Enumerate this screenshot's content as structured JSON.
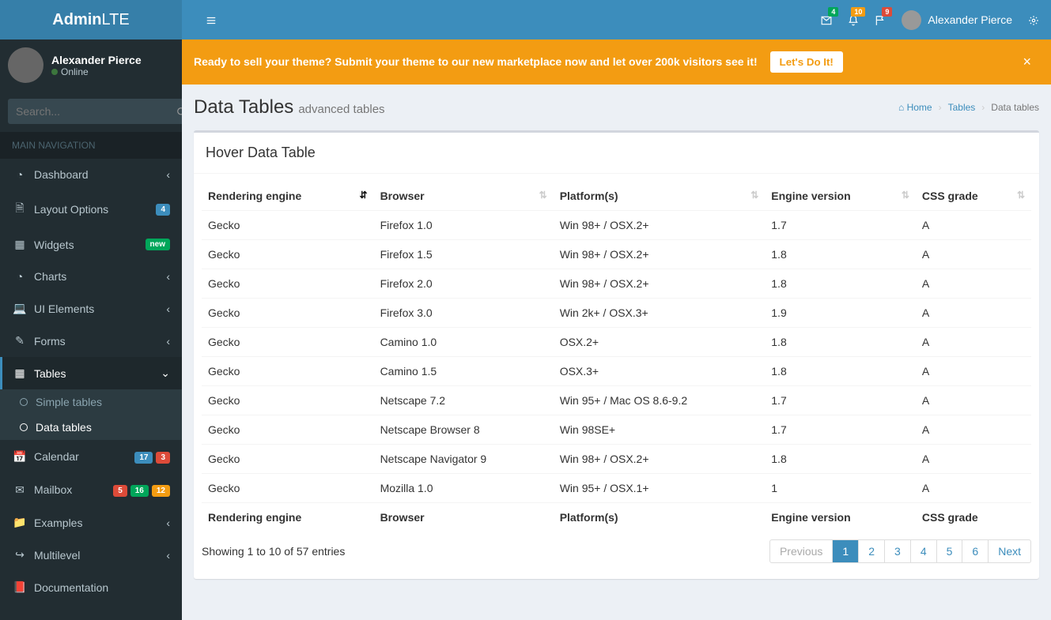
{
  "logo": {
    "b": "Admin",
    "rest": "LTE"
  },
  "header": {
    "badges": {
      "mail": "4",
      "bell": "10",
      "flag": "9"
    },
    "user_name": "Alexander Pierce"
  },
  "sidebar": {
    "user_name": "Alexander Pierce",
    "status": "Online",
    "search_placeholder": "Search...",
    "header": "MAIN NAVIGATION",
    "items": {
      "dashboard": "Dashboard",
      "layout": "Layout Options",
      "layout_badge": "4",
      "widgets": "Widgets",
      "widgets_badge": "new",
      "charts": "Charts",
      "ui": "UI Elements",
      "forms": "Forms",
      "tables": "Tables",
      "simple_tables": "Simple tables",
      "data_tables": "Data tables",
      "calendar": "Calendar",
      "calendar_b1": "17",
      "calendar_b2": "3",
      "mailbox": "Mailbox",
      "mail_b1": "5",
      "mail_b2": "16",
      "mail_b3": "12",
      "examples": "Examples",
      "multilevel": "Multilevel",
      "documentation": "Documentation"
    }
  },
  "alert": {
    "msg": "Ready to sell your theme? Submit your theme to our new marketplace now and let over 200k visitors see it!",
    "btn": "Let's Do It!"
  },
  "page": {
    "title": "Data Tables",
    "subtitle": "advanced tables",
    "crumb_home": "Home",
    "crumb_tables": "Tables",
    "crumb_active": "Data tables"
  },
  "box_title": "Hover Data Table",
  "table": {
    "columns": [
      "Rendering engine",
      "Browser",
      "Platform(s)",
      "Engine version",
      "CSS grade"
    ],
    "rows": [
      [
        "Gecko",
        "Firefox 1.0",
        "Win 98+ / OSX.2+",
        "1.7",
        "A"
      ],
      [
        "Gecko",
        "Firefox 1.5",
        "Win 98+ / OSX.2+",
        "1.8",
        "A"
      ],
      [
        "Gecko",
        "Firefox 2.0",
        "Win 98+ / OSX.2+",
        "1.8",
        "A"
      ],
      [
        "Gecko",
        "Firefox 3.0",
        "Win 2k+ / OSX.3+",
        "1.9",
        "A"
      ],
      [
        "Gecko",
        "Camino 1.0",
        "OSX.2+",
        "1.8",
        "A"
      ],
      [
        "Gecko",
        "Camino 1.5",
        "OSX.3+",
        "1.8",
        "A"
      ],
      [
        "Gecko",
        "Netscape 7.2",
        "Win 95+ / Mac OS 8.6-9.2",
        "1.7",
        "A"
      ],
      [
        "Gecko",
        "Netscape Browser 8",
        "Win 98SE+",
        "1.7",
        "A"
      ],
      [
        "Gecko",
        "Netscape Navigator 9",
        "Win 98+ / OSX.2+",
        "1.8",
        "A"
      ],
      [
        "Gecko",
        "Mozilla 1.0",
        "Win 95+ / OSX.1+",
        "1",
        "A"
      ]
    ],
    "info": "Showing 1 to 10 of 57 entries",
    "pages": [
      "Previous",
      "1",
      "2",
      "3",
      "4",
      "5",
      "6",
      "Next"
    ]
  }
}
